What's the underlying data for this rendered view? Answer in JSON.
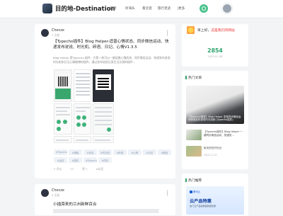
{
  "header": {
    "brand": "目的地-Destination",
    "nav": [
      "首页",
      "听海头",
      "看云瓷",
      "旅行足迹",
      "|更多"
    ]
  },
  "post1": {
    "author": "Chenze",
    "time": "2 天前",
    "title": "【Typecho插件】Blog Helper-适普心情状态、同步微信运动、快递发布说说、时光机、碎语、日记、心情V1.3.5",
    "excerpt": "Blog Helper 是Typecho 插件，它是一款可以一键适普心情状态、同步微信运动、快递发布说说时光机和日记心情微博的插件，通过发布说说记录生活点滴的插件...",
    "tags": [
      "#Typecho",
      "#博客",
      "#说说",
      "#时光机",
      "#碎语",
      "#心情",
      "#日记",
      "#微信",
      "#运动",
      "#插件",
      "#Typecho插件",
      "#同步"
    ],
    "meta": [
      "5 评论",
      "23",
      "赞 3",
      "#标签"
    ]
  },
  "post2": {
    "author": "Chenze",
    "time": "3 天前",
    "title": "小插旁来的兰州新鲜百合"
  },
  "sidebar": {
    "greeting_prefix": "早上好，",
    "greeting_highlight": "这是我们的网站",
    "visits": "2854",
    "visits_date": "2025-01-08",
    "hot_title": "热门文章",
    "hot_main": "【Typecho插件】Blog Helper 发现同步微信运动快递发布说说时光机和 (Typecho插件)",
    "hot_items": [
      {
        "text": "【Typecho插件】Blog Helper 一键同步微信运动，快递发...",
        "date": "2025-01-05"
      },
      {
        "text": "秋天的在时光记",
        "date": "2024-11-20"
      }
    ],
    "rec_title": "热门推荐",
    "ad_logo": "腾讯云",
    "ad_title": "云产品特惠",
    "ad_sub": "热门云产品特惠首购更优惠"
  }
}
